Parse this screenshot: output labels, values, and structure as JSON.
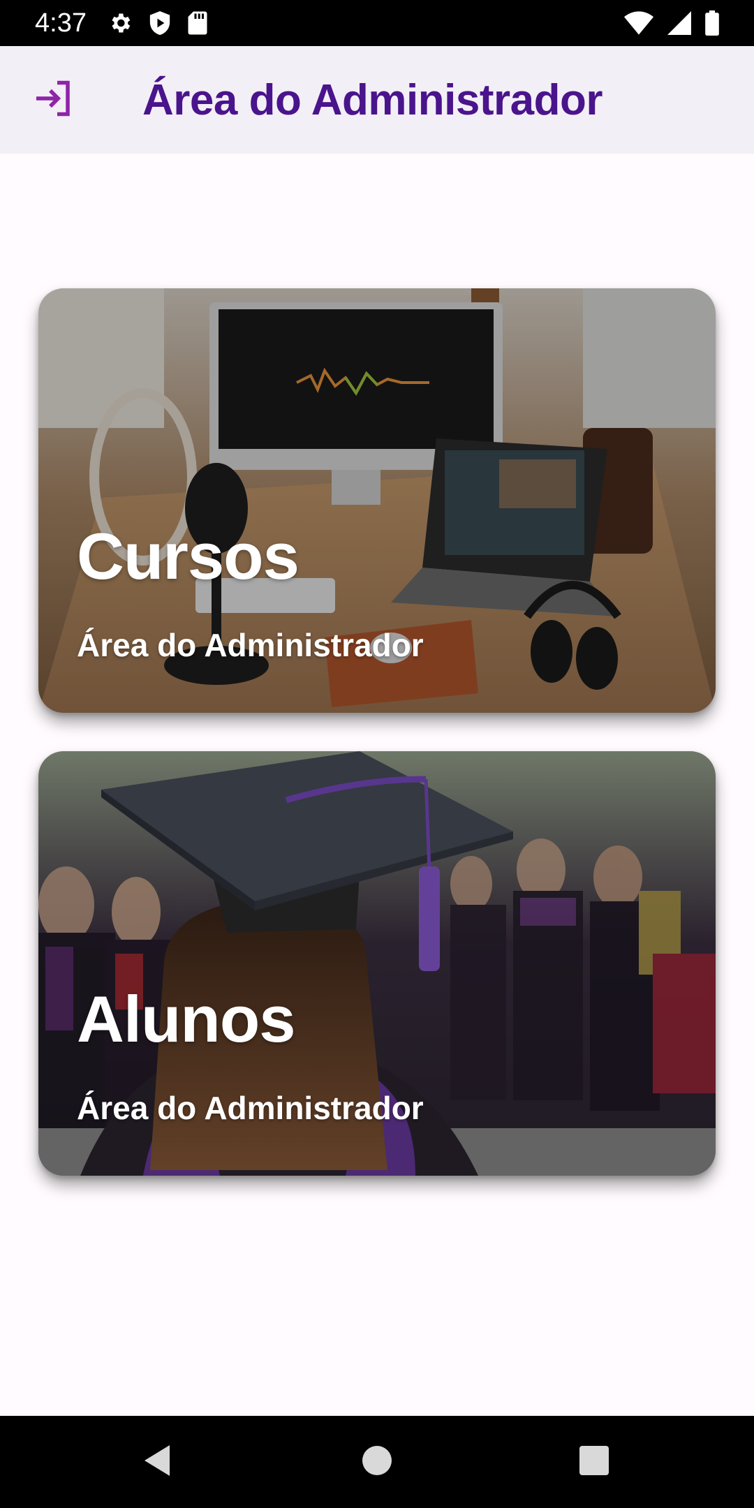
{
  "status_bar": {
    "time": "4:37",
    "left_icons": [
      "gear-icon",
      "shield-play-icon",
      "sd-card-icon"
    ],
    "right_icons": [
      "wifi-icon",
      "signal-icon",
      "battery-icon"
    ]
  },
  "app_bar": {
    "title": "Área do Administrador",
    "login_icon": "login-icon",
    "title_color": "#4a148c",
    "icon_color": "#8e24aa"
  },
  "cards": [
    {
      "title": "Cursos",
      "subtitle": "Área do Administrador",
      "image": "desk-with-computer-and-microphone"
    },
    {
      "title": "Alunos",
      "subtitle": "Área do Administrador",
      "image": "graduate-with-cap"
    }
  ],
  "nav_bar": {
    "buttons": [
      "back-icon",
      "home-icon",
      "recents-icon"
    ]
  }
}
